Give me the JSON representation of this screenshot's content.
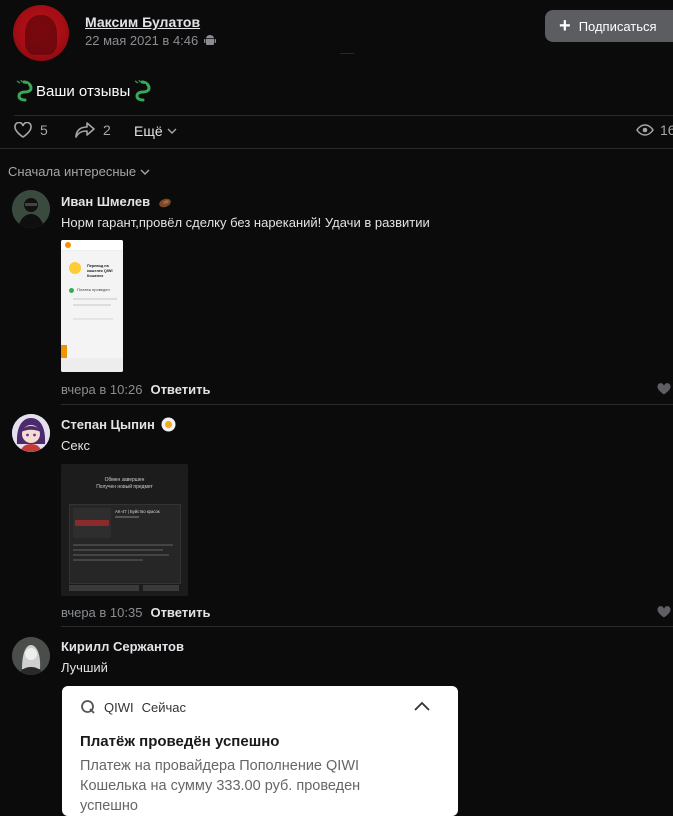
{
  "post": {
    "author": "Максим Булатов",
    "date": "22 мая 2021 в 4:46",
    "subscribe_label": "Подписаться",
    "text": "Ваши отзывы",
    "likes": "5",
    "shares": "2",
    "more_label": "Ещё",
    "views": "16"
  },
  "sort_label": "Сначала интересные",
  "comments": [
    {
      "name": "Иван Шмелев",
      "text": "Норм гарант,провёл сделку без нареканий! Удачи в развитии",
      "time": "вчера в 10:26",
      "reply": "Ответить",
      "attachment": {
        "header": "Перевод на кошелек QIWI Кошелек",
        "status": "Платеж проведен"
      }
    },
    {
      "name": "Степан Цыпин",
      "text": "Секс",
      "time": "вчера в 10:35",
      "reply": "Ответить",
      "attachment": {
        "line1": "Обмен завершен",
        "line2": "Получен новый предмет",
        "item": "AK-47 | Буйство красок"
      }
    },
    {
      "name": "Кирилл Сержантов",
      "text": "Лучший",
      "attachment": {
        "app": "QIWI",
        "when": "Сейчас",
        "title": "Платёж проведён успешно",
        "body": "Платеж на провайдера Пополнение QIWI Кошелька на сумму 333.00 руб. проведен успешно"
      }
    }
  ],
  "colors": {
    "background": "#0b0b0b",
    "text": "#e1e3e6",
    "muted": "#8a8d91",
    "button": "#5c5d60",
    "avatar_red": "#c2131b"
  }
}
